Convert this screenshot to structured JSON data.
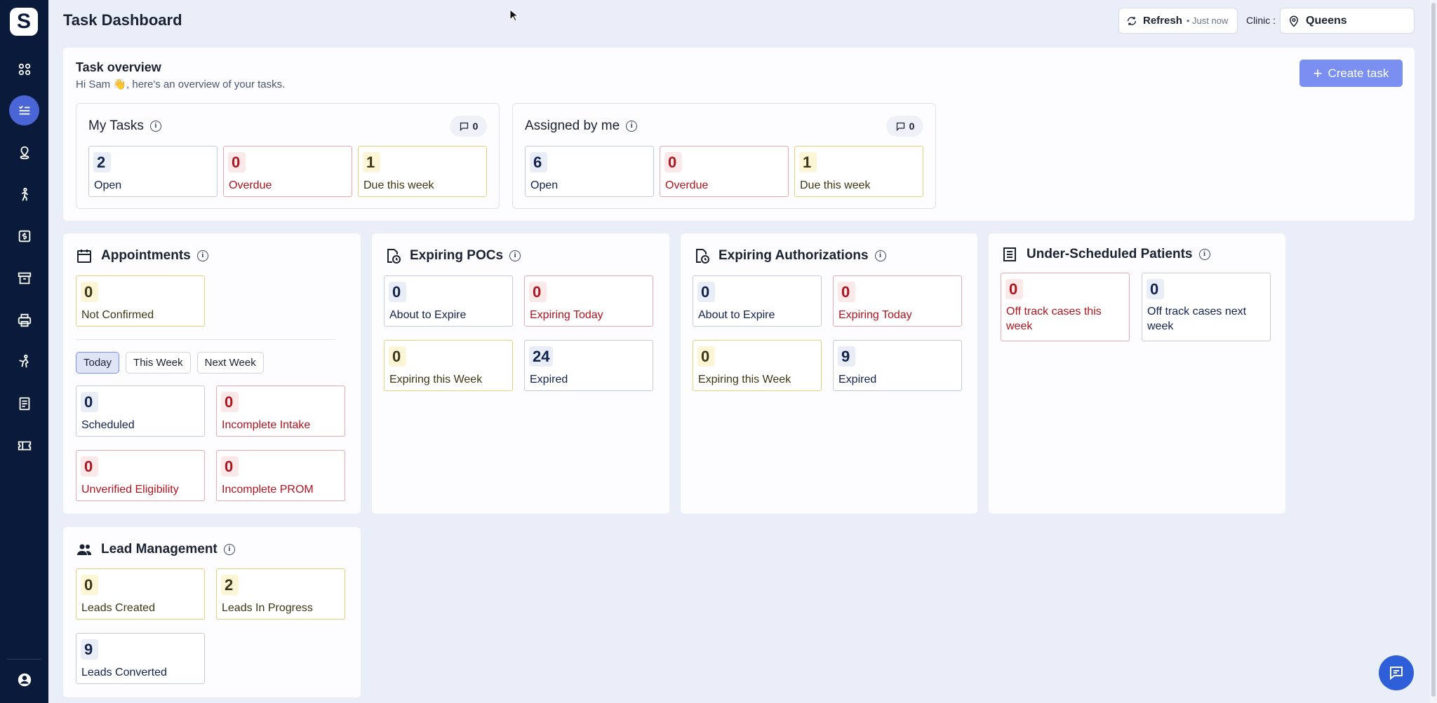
{
  "header": {
    "title": "Task Dashboard",
    "refresh_label": "Refresh",
    "refresh_time": "• Just now",
    "clinic_label": "Clinic :",
    "clinic_value": "Queens"
  },
  "sidebar": {
    "logo": "S",
    "items": [
      {
        "icon": "grid-icon"
      },
      {
        "icon": "tasks-icon",
        "active": true
      },
      {
        "icon": "location-icon"
      },
      {
        "icon": "walking-person-icon"
      },
      {
        "icon": "billing-icon"
      },
      {
        "icon": "archive-icon"
      },
      {
        "icon": "printer-icon"
      },
      {
        "icon": "exercise-icon"
      },
      {
        "icon": "document-icon"
      },
      {
        "icon": "ticket-icon"
      },
      {
        "icon": "user-account-icon"
      }
    ]
  },
  "overview": {
    "title": "Task overview",
    "subtitle": "Hi Sam 👋, here's an overview of your tasks.",
    "create_label": "Create task",
    "my_tasks": {
      "title": "My Tasks",
      "comments": "0",
      "stats": [
        {
          "value": "2",
          "label": "Open"
        },
        {
          "value": "0",
          "label": "Overdue"
        },
        {
          "value": "1",
          "label": "Due this week"
        }
      ]
    },
    "assigned_by_me": {
      "title": "Assigned by me",
      "comments": "0",
      "stats": [
        {
          "value": "6",
          "label": "Open"
        },
        {
          "value": "0",
          "label": "Overdue"
        },
        {
          "value": "1",
          "label": "Due this week"
        }
      ]
    }
  },
  "appointments": {
    "title": "Appointments",
    "not_confirmed": {
      "value": "0",
      "label": "Not Confirmed"
    },
    "tabs": [
      "Today",
      "This Week",
      "Next Week"
    ],
    "active_tab": "Today",
    "stats": [
      {
        "value": "0",
        "label": "Scheduled"
      },
      {
        "value": "0",
        "label": "Incomplete Intake"
      },
      {
        "value": "0",
        "label": "Unverified Eligibility"
      },
      {
        "value": "0",
        "label": "Incomplete PROM"
      }
    ]
  },
  "expiring_pocs": {
    "title": "Expiring POCs",
    "stats": [
      {
        "value": "0",
        "label": "About to Expire"
      },
      {
        "value": "0",
        "label": "Expiring Today"
      },
      {
        "value": "0",
        "label": "Expiring this Week"
      },
      {
        "value": "24",
        "label": "Expired"
      }
    ]
  },
  "expiring_auth": {
    "title": "Expiring Authorizations",
    "stats": [
      {
        "value": "0",
        "label": "About to Expire"
      },
      {
        "value": "0",
        "label": "Expiring Today"
      },
      {
        "value": "0",
        "label": "Expiring this Week"
      },
      {
        "value": "9",
        "label": "Expired"
      }
    ]
  },
  "under_scheduled": {
    "title": "Under-Scheduled Patients",
    "stats": [
      {
        "value": "0",
        "label": "Off track cases this week"
      },
      {
        "value": "0",
        "label": "Off track cases next week"
      }
    ]
  },
  "lead_management": {
    "title": "Lead Management",
    "stats": [
      {
        "value": "0",
        "label": "Leads Created"
      },
      {
        "value": "2",
        "label": "Leads In Progress"
      },
      {
        "value": "9",
        "label": "Leads Converted"
      }
    ]
  },
  "colors": {
    "sidebar_bg": "#0a1a3a",
    "accent": "#4a66d6",
    "create_btn": "#7b8ff0",
    "danger": "#b0141f",
    "navy": "#10224d"
  }
}
